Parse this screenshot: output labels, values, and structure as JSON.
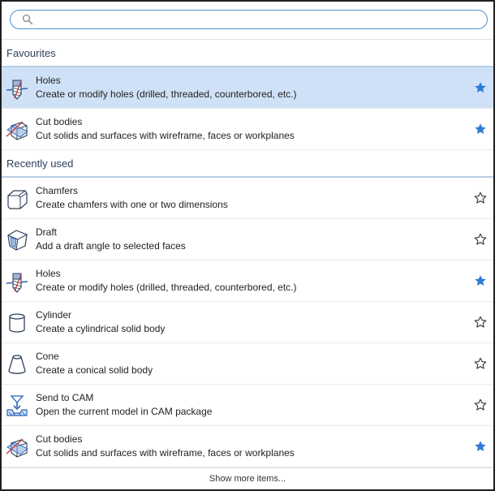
{
  "search": {
    "value": "",
    "placeholder": ""
  },
  "sections": [
    {
      "label": "Favourites"
    },
    {
      "label": "Recently used"
    }
  ],
  "favourites": [
    {
      "title": "Holes",
      "desc": "Create or modify holes (drilled, threaded, counterbored, etc.)",
      "icon": "holes-icon",
      "starred": true,
      "selected": true
    },
    {
      "title": "Cut bodies",
      "desc": "Cut solids and surfaces with wireframe, faces or workplanes",
      "icon": "cut-bodies-icon",
      "starred": true,
      "selected": false
    }
  ],
  "recent": [
    {
      "title": "Chamfers",
      "desc": "Create chamfers with one or two dimensions",
      "icon": "chamfer-icon",
      "starred": false
    },
    {
      "title": "Draft",
      "desc": "Add a draft angle to selected faces",
      "icon": "draft-icon",
      "starred": false
    },
    {
      "title": "Holes",
      "desc": "Create or modify holes (drilled, threaded, counterbored, etc.)",
      "icon": "holes-icon",
      "starred": true
    },
    {
      "title": "Cylinder",
      "desc": "Create a cylindrical solid body",
      "icon": "cylinder-icon",
      "starred": false
    },
    {
      "title": "Cone",
      "desc": "Create a conical solid body",
      "icon": "cone-icon",
      "starred": false
    },
    {
      "title": "Send to CAM",
      "desc": "Open the current model in CAM package",
      "icon": "send-to-cam-icon",
      "starred": false
    },
    {
      "title": "Cut bodies",
      "desc": "Cut solids and surfaces with wireframe, faces or workplanes",
      "icon": "cut-bodies-icon",
      "starred": true
    }
  ],
  "footer": {
    "more_label": "Show more items..."
  },
  "colors": {
    "accent": "#2f7ad6",
    "selected_bg": "#cfe1f6",
    "search_border": "#4a8fd4"
  }
}
